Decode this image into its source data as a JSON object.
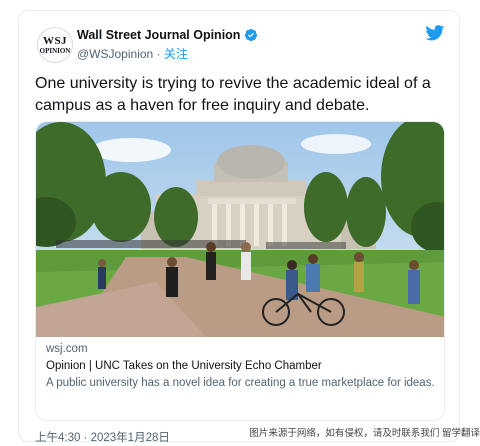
{
  "tweet": {
    "avatar_line1": "WSJ",
    "avatar_line2": "OPINION",
    "display_name": "Wall Street Journal Opinion",
    "handle": "@WSJopinion",
    "separator": " · ",
    "follow_label": "关注",
    "text": "One university is trying to revive the academic ideal of a campus as a haven for free inquiry and debate.",
    "timestamp": "上午4:30 · 2023年1月28日"
  },
  "link_card": {
    "domain": "wsj.com",
    "title": "Opinion | UNC Takes on the University Echo Chamber",
    "description": "A public university has a novel idea for creating a true marketplace for ideas."
  },
  "credit": "图片来源于网络，如有侵权，请及时联系我们 留学翻译",
  "icons": {
    "brand": "twitter-bird-icon",
    "verified": "verified-badge-icon"
  },
  "colors": {
    "accent": "#1d9bf0",
    "text": "#0f1419",
    "muted": "#536471"
  }
}
